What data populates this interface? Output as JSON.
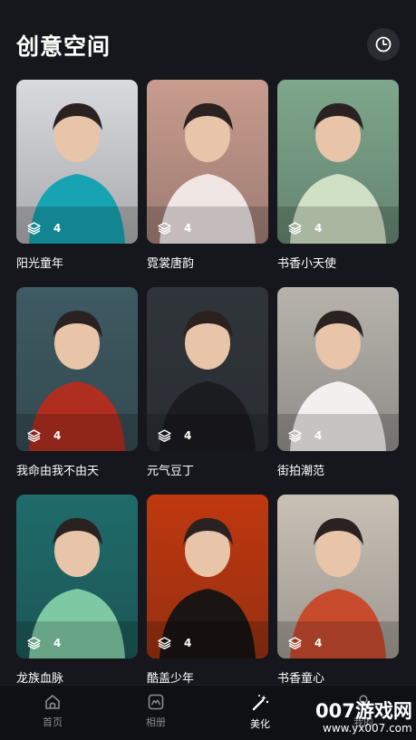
{
  "page": {
    "title": "创意空间",
    "history_icon": "clock-icon"
  },
  "cards": [
    {
      "label": "阳光童年",
      "count": "4",
      "colors": [
        "#d9dadd",
        "#17a3b1"
      ]
    },
    {
      "label": "霓裳唐韵",
      "count": "4",
      "colors": [
        "#c99c8e",
        "#efe6e3"
      ]
    },
    {
      "label": "书香小天使",
      "count": "4",
      "colors": [
        "#7ea78c",
        "#cfe0c5"
      ]
    },
    {
      "label": "我命由我不由天",
      "count": "4",
      "colors": [
        "#3e5a62",
        "#b02e20"
      ]
    },
    {
      "label": "元气豆丁",
      "count": "4",
      "colors": [
        "#30353a",
        "#1b1c20"
      ]
    },
    {
      "label": "街拍潮范",
      "count": "4",
      "colors": [
        "#b7b3ac",
        "#f1f0ee"
      ]
    },
    {
      "label": "龙族血脉",
      "count": "4",
      "colors": [
        "#1f6b6a",
        "#7fc8a4"
      ]
    },
    {
      "label": "酷盖少年",
      "count": "4",
      "colors": [
        "#c0380f",
        "#1a1412"
      ]
    },
    {
      "label": "书香童心",
      "count": "4",
      "colors": [
        "#c9c1b6",
        "#c94b2e"
      ]
    }
  ],
  "tabs": [
    {
      "label": "首页",
      "icon": "home-icon",
      "active": false
    },
    {
      "label": "相册",
      "icon": "album-icon",
      "active": false
    },
    {
      "label": "美化",
      "icon": "magic-wand-icon",
      "active": true
    },
    {
      "label": "我的",
      "icon": "user-icon",
      "active": false
    }
  ],
  "watermark": {
    "text": "007游戏网",
    "url": "www.yx007.com"
  }
}
